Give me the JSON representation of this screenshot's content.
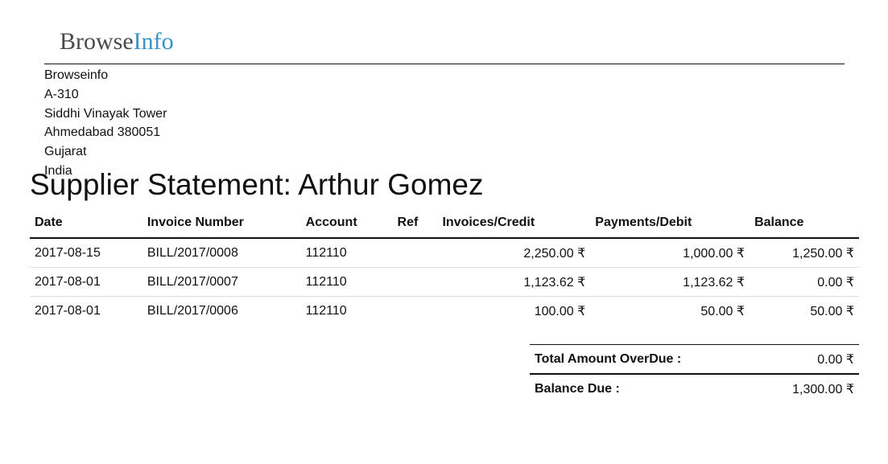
{
  "logo": {
    "part1": "Browse",
    "part2": "Info"
  },
  "company": {
    "name": "Browseinfo",
    "address_lines": [
      "A-310",
      "Siddhi Vinayak Tower",
      "Ahmedabad 380051",
      "Gujarat",
      "India"
    ]
  },
  "title": "Supplier Statement: Arthur Gomez",
  "table": {
    "headers": [
      "Date",
      "Invoice Number",
      "Account",
      "Ref",
      "Invoices/Credit",
      "Payments/Debit",
      "Balance"
    ],
    "rows": [
      {
        "date": "2017-08-15",
        "invoice": "BILL/2017/0008",
        "account": "112110",
        "ref": "",
        "credit": "2,250.00 ₹",
        "debit": "1,000.00 ₹",
        "balance": "1,250.00 ₹"
      },
      {
        "date": "2017-08-01",
        "invoice": "BILL/2017/0007",
        "account": "112110",
        "ref": "",
        "credit": "1,123.62 ₹",
        "debit": "1,123.62 ₹",
        "balance": "0.00 ₹"
      },
      {
        "date": "2017-08-01",
        "invoice": "BILL/2017/0006",
        "account": "112110",
        "ref": "",
        "credit": "100.00 ₹",
        "debit": "50.00 ₹",
        "balance": "50.00 ₹"
      }
    ]
  },
  "totals": {
    "overdue_label": "Total Amount OverDue :",
    "overdue_value": "0.00 ₹",
    "balance_label": "Balance Due :",
    "balance_value": "1,300.00 ₹"
  }
}
